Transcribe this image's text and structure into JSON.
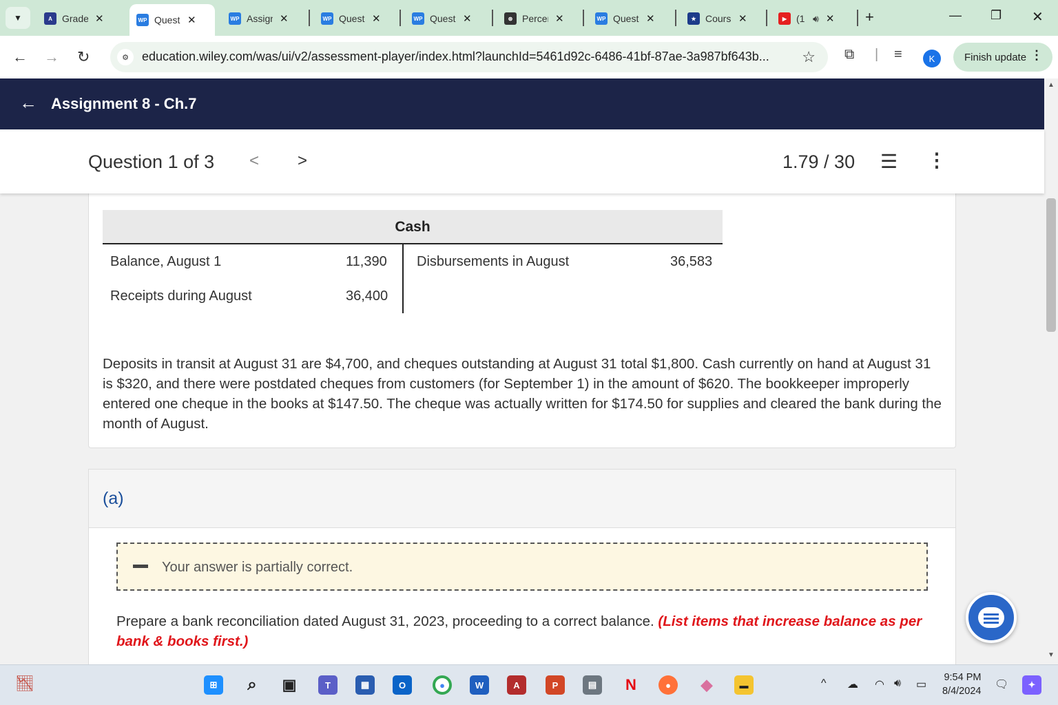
{
  "browser": {
    "tabs": [
      {
        "title": "Grade",
        "favicon": "A",
        "color": "#2a3a8c"
      },
      {
        "title": "Quest",
        "favicon": "WP",
        "color": "#2a7de1"
      },
      {
        "title": "Assign",
        "favicon": "WP",
        "color": "#2a7de1"
      },
      {
        "title": "Quest",
        "favicon": "WP",
        "color": "#2a7de1"
      },
      {
        "title": "Quest",
        "favicon": "WP",
        "color": "#2a7de1"
      },
      {
        "title": "Percer",
        "favicon": "⊛",
        "color": "#333333"
      },
      {
        "title": "Quest",
        "favicon": "WP",
        "color": "#2a7de1"
      },
      {
        "title": "Cours",
        "favicon": "★",
        "color": "#1c3b8a"
      },
      {
        "title": "(1",
        "favicon": "▶",
        "color": "#e52020"
      }
    ],
    "url": "education.wiley.com/was/ui/v2/assessment-player/index.html?launchId=5461d92c-6486-41bf-87ae-3a987bf643b...",
    "profile_initial": "K",
    "finish_update": "Finish update"
  },
  "header": {
    "title": "Assignment 8 - Ch.7"
  },
  "question_nav": {
    "counter": "Question 1 of 3",
    "score": "1.79 / 30"
  },
  "t_account": {
    "title": "Cash",
    "left": [
      {
        "label": "Balance, August 1",
        "amount": "11,390"
      },
      {
        "label": "Receipts during August",
        "amount": "36,400"
      }
    ],
    "right": [
      {
        "label": "Disbursements in August",
        "amount": "36,583"
      }
    ]
  },
  "problem_text": "Deposits in transit at August 31 are $4,700, and cheques outstanding at August 31 total $1,800. Cash currently on hand at August 31 is $320, and there were postdated cheques from customers (for September 1) in the amount of $620. The bookkeeper improperly entered one cheque in the books at $147.50. The cheque was actually written for $174.50 for supplies and cleared the bank during the month of August.",
  "part_a": {
    "label": "(a)",
    "feedback": "Your answer is partially correct.",
    "instruction": "Prepare a bank reconciliation dated August 31, 2023, proceeding to a correct balance.",
    "instruction_note": "(List items that increase balance as per bank & books first.)"
  },
  "taskbar": {
    "time": "9:54 PM",
    "date": "8/4/2024"
  }
}
